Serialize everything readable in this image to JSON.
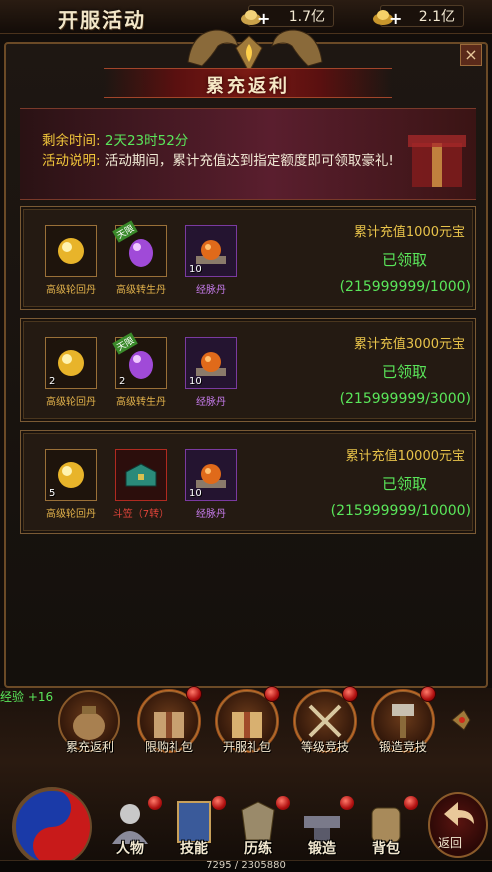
{
  "topbar": {
    "title": "开服活动",
    "resource1": "1.7亿",
    "resource2": "2.1亿",
    "plus": "+"
  },
  "window": {
    "banner_title": "累充返利",
    "close": "×",
    "remaining_label": "剩余时间:",
    "remaining_value": "2天23时52分",
    "desc_label": "活动说明:",
    "desc_value": "活动期间，累计充值达到指定额度即可领取豪礼!"
  },
  "rewards": [
    {
      "title": "累计充值1000元宝",
      "status": "已领取",
      "progress": "(215999999/1000)",
      "items": [
        {
          "name": "高级轮回丹",
          "count": "",
          "tag": ""
        },
        {
          "name": "高级转生丹",
          "count": "",
          "tag": "天限"
        },
        {
          "name": "经脉丹",
          "count": "10",
          "tag": ""
        }
      ]
    },
    {
      "title": "累计充值3000元宝",
      "status": "已领取",
      "progress": "(215999999/3000)",
      "items": [
        {
          "name": "高级轮回丹",
          "count": "2",
          "tag": ""
        },
        {
          "name": "高级转生丹",
          "count": "2",
          "tag": "天限"
        },
        {
          "name": "经脉丹",
          "count": "10",
          "tag": ""
        }
      ]
    },
    {
      "title": "累计充值10000元宝",
      "status": "已领取",
      "progress": "(215999999/10000)",
      "items": [
        {
          "name": "高级轮回丹",
          "count": "5",
          "tag": ""
        },
        {
          "name": "斗笠（7转）",
          "count": "",
          "tag": ""
        },
        {
          "name": "经脉丹",
          "count": "10",
          "tag": ""
        }
      ]
    }
  ],
  "exp_gain": "经验 +16",
  "menu": [
    {
      "label": "累充返利"
    },
    {
      "label": "限购礼包"
    },
    {
      "label": "开服礼包"
    },
    {
      "label": "等级竞技"
    },
    {
      "label": "锻造竞技"
    }
  ],
  "nav": [
    {
      "label": "人物"
    },
    {
      "label": "技能"
    },
    {
      "label": "历练"
    },
    {
      "label": "锻造"
    },
    {
      "label": "背包"
    }
  ],
  "back_label": "返回",
  "exp_bar_text": "7295 / 2305880",
  "colors": {
    "accent_gold": "#e8c34a",
    "claimed_green": "#5ae65a",
    "frame_bronze": "#7a5a34"
  }
}
